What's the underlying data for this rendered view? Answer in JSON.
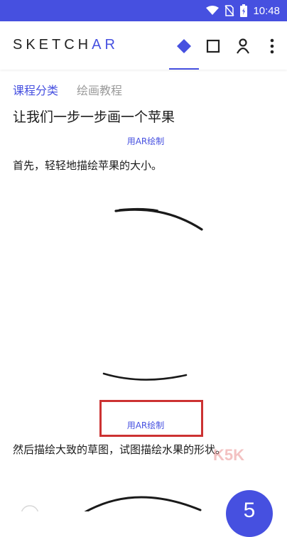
{
  "status": {
    "time": "10:48"
  },
  "app": {
    "logo_main": "SKETCH",
    "logo_accent": "AR"
  },
  "toolbar": {
    "icons": [
      "diamond-icon",
      "square-icon",
      "person-icon",
      "more-vert-icon"
    ]
  },
  "tabs": [
    {
      "label": "课程分类",
      "active": true
    },
    {
      "label": "绘画教程",
      "active": false
    }
  ],
  "lesson": {
    "title": "让我们一步一步画一个苹果",
    "draw_ar_label": "用AR绘制",
    "steps": [
      {
        "text": "首先，轻轻地描绘苹果的大小。"
      },
      {
        "text": "然后描绘大致的草图，试图描绘水果的形状。"
      }
    ]
  },
  "fab": {
    "label": "5"
  },
  "watermark": {
    "text": "K5K"
  },
  "colors": {
    "accent": "#4650e0",
    "highlight": "#cc3232"
  }
}
